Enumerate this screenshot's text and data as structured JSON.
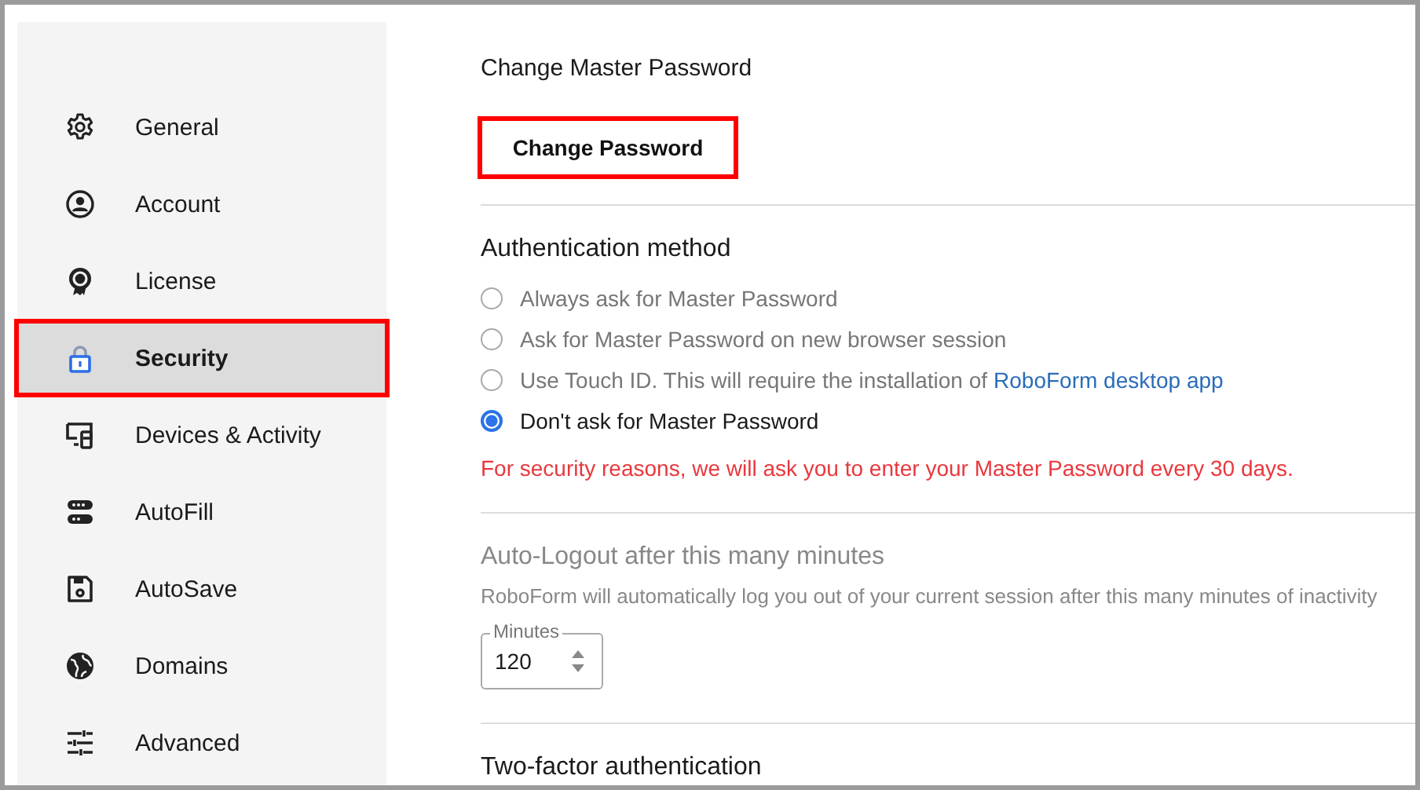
{
  "sidebar": {
    "items": [
      {
        "label": "General",
        "kind": "gear",
        "selected": false,
        "highlighted": false
      },
      {
        "label": "Account",
        "kind": "account",
        "selected": false,
        "highlighted": false
      },
      {
        "label": "License",
        "kind": "badge",
        "selected": false,
        "highlighted": false
      },
      {
        "label": "Security",
        "kind": "lock",
        "selected": true,
        "highlighted": true
      },
      {
        "label": "Devices & Activity",
        "kind": "devices",
        "selected": false,
        "highlighted": false
      },
      {
        "label": "AutoFill",
        "kind": "autofill",
        "selected": false,
        "highlighted": false
      },
      {
        "label": "AutoSave",
        "kind": "save",
        "selected": false,
        "highlighted": false
      },
      {
        "label": "Domains",
        "kind": "globe",
        "selected": false,
        "highlighted": false
      },
      {
        "label": "Advanced",
        "kind": "sliders",
        "selected": false,
        "highlighted": false
      }
    ]
  },
  "master_password": {
    "title": "Change Master Password",
    "button": {
      "label": "Change Password",
      "highlighted": true
    }
  },
  "authentication": {
    "title": "Authentication method",
    "options": [
      {
        "text": "Always ask for Master Password",
        "selected": false,
        "disabled": true
      },
      {
        "text": "Ask for Master Password on new browser session",
        "selected": false,
        "disabled": true
      },
      {
        "text": "Use Touch ID. This will require the installation of",
        "link": "RoboForm desktop app",
        "selected": false,
        "disabled": true
      },
      {
        "text": "Don't ask for Master Password",
        "selected": true,
        "disabled": false
      }
    ],
    "warning": "For security reasons, we will ask you to enter your Master Password every 30 days."
  },
  "auto_logout": {
    "title": "Auto-Logout after this many minutes",
    "disabled": true,
    "description": "RoboForm will automatically log you out of your current session after this many minutes of inactivity",
    "field": {
      "label": "Minutes",
      "value": "120"
    }
  },
  "two_factor": {
    "title": "Two-factor authentication"
  }
}
